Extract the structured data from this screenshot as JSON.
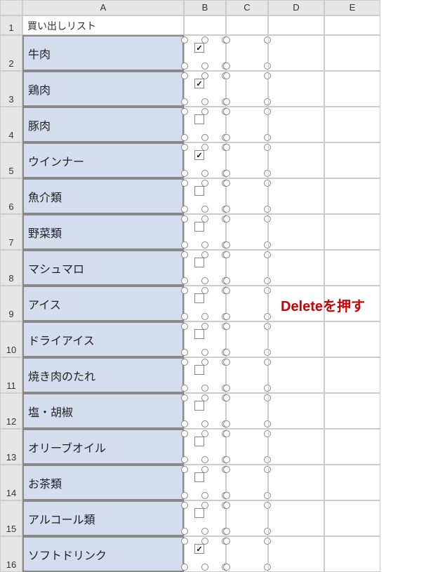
{
  "columns": [
    "A",
    "B",
    "C",
    "D",
    "E"
  ],
  "header_row": {
    "number": "1",
    "title": "買い出しリスト"
  },
  "rows": [
    {
      "number": "2",
      "label": "牛肉",
      "checked": true
    },
    {
      "number": "3",
      "label": "鶏肉",
      "checked": true
    },
    {
      "number": "4",
      "label": "豚肉",
      "checked": false
    },
    {
      "number": "5",
      "label": "ウインナー",
      "checked": true
    },
    {
      "number": "6",
      "label": "魚介類",
      "checked": false
    },
    {
      "number": "7",
      "label": "野菜類",
      "checked": false
    },
    {
      "number": "8",
      "label": "マシュマロ",
      "checked": false
    },
    {
      "number": "9",
      "label": "アイス",
      "checked": false
    },
    {
      "number": "10",
      "label": "ドライアイス",
      "checked": false
    },
    {
      "number": "11",
      "label": "焼き肉のたれ",
      "checked": false
    },
    {
      "number": "12",
      "label": "塩・胡椒",
      "checked": false
    },
    {
      "number": "13",
      "label": "オリーブオイル",
      "checked": false
    },
    {
      "number": "14",
      "label": "お茶類",
      "checked": false
    },
    {
      "number": "15",
      "label": "アルコール類",
      "checked": false
    },
    {
      "number": "16",
      "label": "ソフトドリンク",
      "checked": true
    }
  ],
  "annotation": "Deleteを押す"
}
